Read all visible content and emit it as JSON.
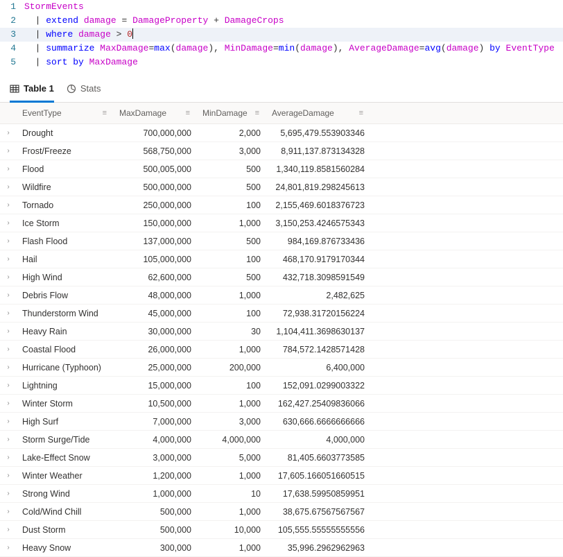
{
  "editor": {
    "lines": [
      {
        "num": "1"
      },
      {
        "num": "2"
      },
      {
        "num": "3"
      },
      {
        "num": "4"
      },
      {
        "num": "5"
      }
    ],
    "tokens": {
      "l1_storm": "StormEvents",
      "l2_pipe": "|",
      "l2_extend": "extend",
      "l2_damage": "damage",
      "l2_eq": " = ",
      "l2_dp": "DamageProperty",
      "l2_plus": " + ",
      "l2_dc": "DamageCrops",
      "l3_pipe": "|",
      "l3_where": "where",
      "l3_damage": "damage",
      "l3_gt": " > ",
      "l3_zero": "0",
      "l4_pipe": "|",
      "l4_sum": "summarize",
      "l4_maxd": "MaxDamage",
      "l4_eq1": "=",
      "l4_max": "max",
      "l4_lp1": "(",
      "l4_d1": "damage",
      "l4_rp1": ")",
      "l4_c1": ", ",
      "l4_mind": "MinDamage",
      "l4_eq2": "=",
      "l4_min": "min",
      "l4_lp2": "(",
      "l4_d2": "damage",
      "l4_rp2": ")",
      "l4_c2": ", ",
      "l4_avgd": "AverageDamage",
      "l4_eq3": "=",
      "l4_avg": "avg",
      "l4_lp3": "(",
      "l4_d3": "damage",
      "l4_rp3": ")",
      "l4_by": " by ",
      "l4_et": "EventType",
      "l5_pipe": "|",
      "l5_sort": "sort",
      "l5_by": " by ",
      "l5_maxd": "MaxDamage"
    }
  },
  "tabs": {
    "table": "Table 1",
    "stats": "Stats"
  },
  "grid": {
    "headers": {
      "event": "EventType",
      "max": "MaxDamage",
      "min": "MinDamage",
      "avg": "AverageDamage"
    },
    "menu_glyph": "≡",
    "rows": [
      {
        "event": "Drought",
        "max": "700,000,000",
        "min": "2,000",
        "avg": "5,695,479.553903346"
      },
      {
        "event": "Frost/Freeze",
        "max": "568,750,000",
        "min": "3,000",
        "avg": "8,911,137.873134328"
      },
      {
        "event": "Flood",
        "max": "500,005,000",
        "min": "500",
        "avg": "1,340,119.8581560284"
      },
      {
        "event": "Wildfire",
        "max": "500,000,000",
        "min": "500",
        "avg": "24,801,819.298245613"
      },
      {
        "event": "Tornado",
        "max": "250,000,000",
        "min": "100",
        "avg": "2,155,469.6018376723"
      },
      {
        "event": "Ice Storm",
        "max": "150,000,000",
        "min": "1,000",
        "avg": "3,150,253.4246575343"
      },
      {
        "event": "Flash Flood",
        "max": "137,000,000",
        "min": "500",
        "avg": "984,169.876733436"
      },
      {
        "event": "Hail",
        "max": "105,000,000",
        "min": "100",
        "avg": "468,170.9179170344"
      },
      {
        "event": "High Wind",
        "max": "62,600,000",
        "min": "500",
        "avg": "432,718.3098591549"
      },
      {
        "event": "Debris Flow",
        "max": "48,000,000",
        "min": "1,000",
        "avg": "2,482,625"
      },
      {
        "event": "Thunderstorm Wind",
        "max": "45,000,000",
        "min": "100",
        "avg": "72,938.31720156224"
      },
      {
        "event": "Heavy Rain",
        "max": "30,000,000",
        "min": "30",
        "avg": "1,104,411.3698630137"
      },
      {
        "event": "Coastal Flood",
        "max": "26,000,000",
        "min": "1,000",
        "avg": "784,572.1428571428"
      },
      {
        "event": "Hurricane (Typhoon)",
        "max": "25,000,000",
        "min": "200,000",
        "avg": "6,400,000"
      },
      {
        "event": "Lightning",
        "max": "15,000,000",
        "min": "100",
        "avg": "152,091.0299003322"
      },
      {
        "event": "Winter Storm",
        "max": "10,500,000",
        "min": "1,000",
        "avg": "162,427.25409836066"
      },
      {
        "event": "High Surf",
        "max": "7,000,000",
        "min": "3,000",
        "avg": "630,666.6666666666"
      },
      {
        "event": "Storm Surge/Tide",
        "max": "4,000,000",
        "min": "4,000,000",
        "avg": "4,000,000"
      },
      {
        "event": "Lake-Effect Snow",
        "max": "3,000,000",
        "min": "5,000",
        "avg": "81,405.6603773585"
      },
      {
        "event": "Winter Weather",
        "max": "1,200,000",
        "min": "1,000",
        "avg": "17,605.166051660515"
      },
      {
        "event": "Strong Wind",
        "max": "1,000,000",
        "min": "10",
        "avg": "17,638.59950859951"
      },
      {
        "event": "Cold/Wind Chill",
        "max": "500,000",
        "min": "1,000",
        "avg": "38,675.67567567567"
      },
      {
        "event": "Dust Storm",
        "max": "500,000",
        "min": "10,000",
        "avg": "105,555.55555555556"
      },
      {
        "event": "Heavy Snow",
        "max": "300,000",
        "min": "1,000",
        "avg": "35,996.2962962963"
      }
    ]
  },
  "chart_data": {
    "type": "table",
    "title": "",
    "columns": [
      "EventType",
      "MaxDamage",
      "MinDamage",
      "AverageDamage"
    ],
    "rows": [
      [
        "Drought",
        700000000,
        2000,
        5695479.553903346
      ],
      [
        "Frost/Freeze",
        568750000,
        3000,
        8911137.873134328
      ],
      [
        "Flood",
        500005000,
        500,
        1340119.8581560284
      ],
      [
        "Wildfire",
        500000000,
        500,
        24801819.298245613
      ],
      [
        "Tornado",
        250000000,
        100,
        2155469.6018376723
      ],
      [
        "Ice Storm",
        150000000,
        1000,
        3150253.4246575343
      ],
      [
        "Flash Flood",
        137000000,
        500,
        984169.876733436
      ],
      [
        "Hail",
        105000000,
        100,
        468170.9179170344
      ],
      [
        "High Wind",
        62600000,
        500,
        432718.3098591549
      ],
      [
        "Debris Flow",
        48000000,
        1000,
        2482625
      ],
      [
        "Thunderstorm Wind",
        45000000,
        100,
        72938.31720156224
      ],
      [
        "Heavy Rain",
        30000000,
        30,
        1104411.3698630137
      ],
      [
        "Coastal Flood",
        26000000,
        1000,
        784572.1428571428
      ],
      [
        "Hurricane (Typhoon)",
        25000000,
        200000,
        6400000
      ],
      [
        "Lightning",
        15000000,
        100,
        152091.0299003322
      ],
      [
        "Winter Storm",
        10500000,
        1000,
        162427.25409836066
      ],
      [
        "High Surf",
        7000000,
        3000,
        630666.6666666666
      ],
      [
        "Storm Surge/Tide",
        4000000,
        4000000,
        4000000
      ],
      [
        "Lake-Effect Snow",
        3000000,
        5000,
        81405.6603773585
      ],
      [
        "Winter Weather",
        1200000,
        1000,
        17605.166051660515
      ],
      [
        "Strong Wind",
        1000000,
        10,
        17638.59950859951
      ],
      [
        "Cold/Wind Chill",
        500000,
        1000,
        38675.67567567567
      ],
      [
        "Dust Storm",
        500000,
        10000,
        105555.55555555556
      ],
      [
        "Heavy Snow",
        300000,
        1000,
        35996.2962962963
      ]
    ]
  }
}
